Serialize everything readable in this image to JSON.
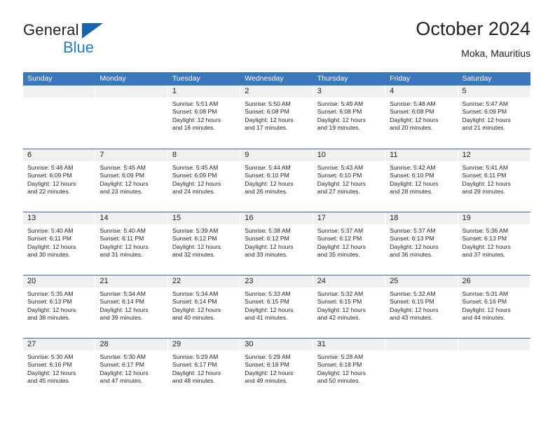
{
  "brand": {
    "line1": "General",
    "line2": "Blue",
    "triangle_color": "#1565b0",
    "line2_color": "#1d7fd0"
  },
  "header": {
    "title": "October 2024",
    "subtitle": "Moka, Mauritius"
  },
  "colors": {
    "header_blue": "#3b77bd",
    "row_rule_blue": "#2f6cb0",
    "daynum_strip": "#f0f0f0",
    "text": "#231f20"
  },
  "weekdays": [
    "Sunday",
    "Monday",
    "Tuesday",
    "Wednesday",
    "Thursday",
    "Friday",
    "Saturday"
  ],
  "weeks": [
    [
      {
        "day": "",
        "sunrise": "",
        "sunset": "",
        "daylight1": "",
        "daylight2": ""
      },
      {
        "day": "",
        "sunrise": "",
        "sunset": "",
        "daylight1": "",
        "daylight2": ""
      },
      {
        "day": "1",
        "sunrise": "Sunrise: 5:51 AM",
        "sunset": "Sunset: 6:08 PM",
        "daylight1": "Daylight: 12 hours",
        "daylight2": "and 16 minutes."
      },
      {
        "day": "2",
        "sunrise": "Sunrise: 5:50 AM",
        "sunset": "Sunset: 6:08 PM",
        "daylight1": "Daylight: 12 hours",
        "daylight2": "and 17 minutes."
      },
      {
        "day": "3",
        "sunrise": "Sunrise: 5:49 AM",
        "sunset": "Sunset: 6:08 PM",
        "daylight1": "Daylight: 12 hours",
        "daylight2": "and 19 minutes."
      },
      {
        "day": "4",
        "sunrise": "Sunrise: 5:48 AM",
        "sunset": "Sunset: 6:08 PM",
        "daylight1": "Daylight: 12 hours",
        "daylight2": "and 20 minutes."
      },
      {
        "day": "5",
        "sunrise": "Sunrise: 5:47 AM",
        "sunset": "Sunset: 6:09 PM",
        "daylight1": "Daylight: 12 hours",
        "daylight2": "and 21 minutes."
      }
    ],
    [
      {
        "day": "6",
        "sunrise": "Sunrise: 5:46 AM",
        "sunset": "Sunset: 6:09 PM",
        "daylight1": "Daylight: 12 hours",
        "daylight2": "and 22 minutes."
      },
      {
        "day": "7",
        "sunrise": "Sunrise: 5:45 AM",
        "sunset": "Sunset: 6:09 PM",
        "daylight1": "Daylight: 12 hours",
        "daylight2": "and 23 minutes."
      },
      {
        "day": "8",
        "sunrise": "Sunrise: 5:45 AM",
        "sunset": "Sunset: 6:09 PM",
        "daylight1": "Daylight: 12 hours",
        "daylight2": "and 24 minutes."
      },
      {
        "day": "9",
        "sunrise": "Sunrise: 5:44 AM",
        "sunset": "Sunset: 6:10 PM",
        "daylight1": "Daylight: 12 hours",
        "daylight2": "and 26 minutes."
      },
      {
        "day": "10",
        "sunrise": "Sunrise: 5:43 AM",
        "sunset": "Sunset: 6:10 PM",
        "daylight1": "Daylight: 12 hours",
        "daylight2": "and 27 minutes."
      },
      {
        "day": "11",
        "sunrise": "Sunrise: 5:42 AM",
        "sunset": "Sunset: 6:10 PM",
        "daylight1": "Daylight: 12 hours",
        "daylight2": "and 28 minutes."
      },
      {
        "day": "12",
        "sunrise": "Sunrise: 5:41 AM",
        "sunset": "Sunset: 6:11 PM",
        "daylight1": "Daylight: 12 hours",
        "daylight2": "and 29 minutes."
      }
    ],
    [
      {
        "day": "13",
        "sunrise": "Sunrise: 5:40 AM",
        "sunset": "Sunset: 6:11 PM",
        "daylight1": "Daylight: 12 hours",
        "daylight2": "and 30 minutes."
      },
      {
        "day": "14",
        "sunrise": "Sunrise: 5:40 AM",
        "sunset": "Sunset: 6:11 PM",
        "daylight1": "Daylight: 12 hours",
        "daylight2": "and 31 minutes."
      },
      {
        "day": "15",
        "sunrise": "Sunrise: 5:39 AM",
        "sunset": "Sunset: 6:12 PM",
        "daylight1": "Daylight: 12 hours",
        "daylight2": "and 32 minutes."
      },
      {
        "day": "16",
        "sunrise": "Sunrise: 5:38 AM",
        "sunset": "Sunset: 6:12 PM",
        "daylight1": "Daylight: 12 hours",
        "daylight2": "and 33 minutes."
      },
      {
        "day": "17",
        "sunrise": "Sunrise: 5:37 AM",
        "sunset": "Sunset: 6:12 PM",
        "daylight1": "Daylight: 12 hours",
        "daylight2": "and 35 minutes."
      },
      {
        "day": "18",
        "sunrise": "Sunrise: 5:37 AM",
        "sunset": "Sunset: 6:13 PM",
        "daylight1": "Daylight: 12 hours",
        "daylight2": "and 36 minutes."
      },
      {
        "day": "19",
        "sunrise": "Sunrise: 5:36 AM",
        "sunset": "Sunset: 6:13 PM",
        "daylight1": "Daylight: 12 hours",
        "daylight2": "and 37 minutes."
      }
    ],
    [
      {
        "day": "20",
        "sunrise": "Sunrise: 5:35 AM",
        "sunset": "Sunset: 6:13 PM",
        "daylight1": "Daylight: 12 hours",
        "daylight2": "and 38 minutes."
      },
      {
        "day": "21",
        "sunrise": "Sunrise: 5:34 AM",
        "sunset": "Sunset: 6:14 PM",
        "daylight1": "Daylight: 12 hours",
        "daylight2": "and 39 minutes."
      },
      {
        "day": "22",
        "sunrise": "Sunrise: 5:34 AM",
        "sunset": "Sunset: 6:14 PM",
        "daylight1": "Daylight: 12 hours",
        "daylight2": "and 40 minutes."
      },
      {
        "day": "23",
        "sunrise": "Sunrise: 5:33 AM",
        "sunset": "Sunset: 6:15 PM",
        "daylight1": "Daylight: 12 hours",
        "daylight2": "and 41 minutes."
      },
      {
        "day": "24",
        "sunrise": "Sunrise: 5:32 AM",
        "sunset": "Sunset: 6:15 PM",
        "daylight1": "Daylight: 12 hours",
        "daylight2": "and 42 minutes."
      },
      {
        "day": "25",
        "sunrise": "Sunrise: 5:32 AM",
        "sunset": "Sunset: 6:15 PM",
        "daylight1": "Daylight: 12 hours",
        "daylight2": "and 43 minutes."
      },
      {
        "day": "26",
        "sunrise": "Sunrise: 5:31 AM",
        "sunset": "Sunset: 6:16 PM",
        "daylight1": "Daylight: 12 hours",
        "daylight2": "and 44 minutes."
      }
    ],
    [
      {
        "day": "27",
        "sunrise": "Sunrise: 5:30 AM",
        "sunset": "Sunset: 6:16 PM",
        "daylight1": "Daylight: 12 hours",
        "daylight2": "and 45 minutes."
      },
      {
        "day": "28",
        "sunrise": "Sunrise: 5:30 AM",
        "sunset": "Sunset: 6:17 PM",
        "daylight1": "Daylight: 12 hours",
        "daylight2": "and 47 minutes."
      },
      {
        "day": "29",
        "sunrise": "Sunrise: 5:29 AM",
        "sunset": "Sunset: 6:17 PM",
        "daylight1": "Daylight: 12 hours",
        "daylight2": "and 48 minutes."
      },
      {
        "day": "30",
        "sunrise": "Sunrise: 5:29 AM",
        "sunset": "Sunset: 6:18 PM",
        "daylight1": "Daylight: 12 hours",
        "daylight2": "and 49 minutes."
      },
      {
        "day": "31",
        "sunrise": "Sunrise: 5:28 AM",
        "sunset": "Sunset: 6:18 PM",
        "daylight1": "Daylight: 12 hours",
        "daylight2": "and 50 minutes."
      },
      {
        "day": "",
        "sunrise": "",
        "sunset": "",
        "daylight1": "",
        "daylight2": ""
      },
      {
        "day": "",
        "sunrise": "",
        "sunset": "",
        "daylight1": "",
        "daylight2": ""
      }
    ]
  ]
}
